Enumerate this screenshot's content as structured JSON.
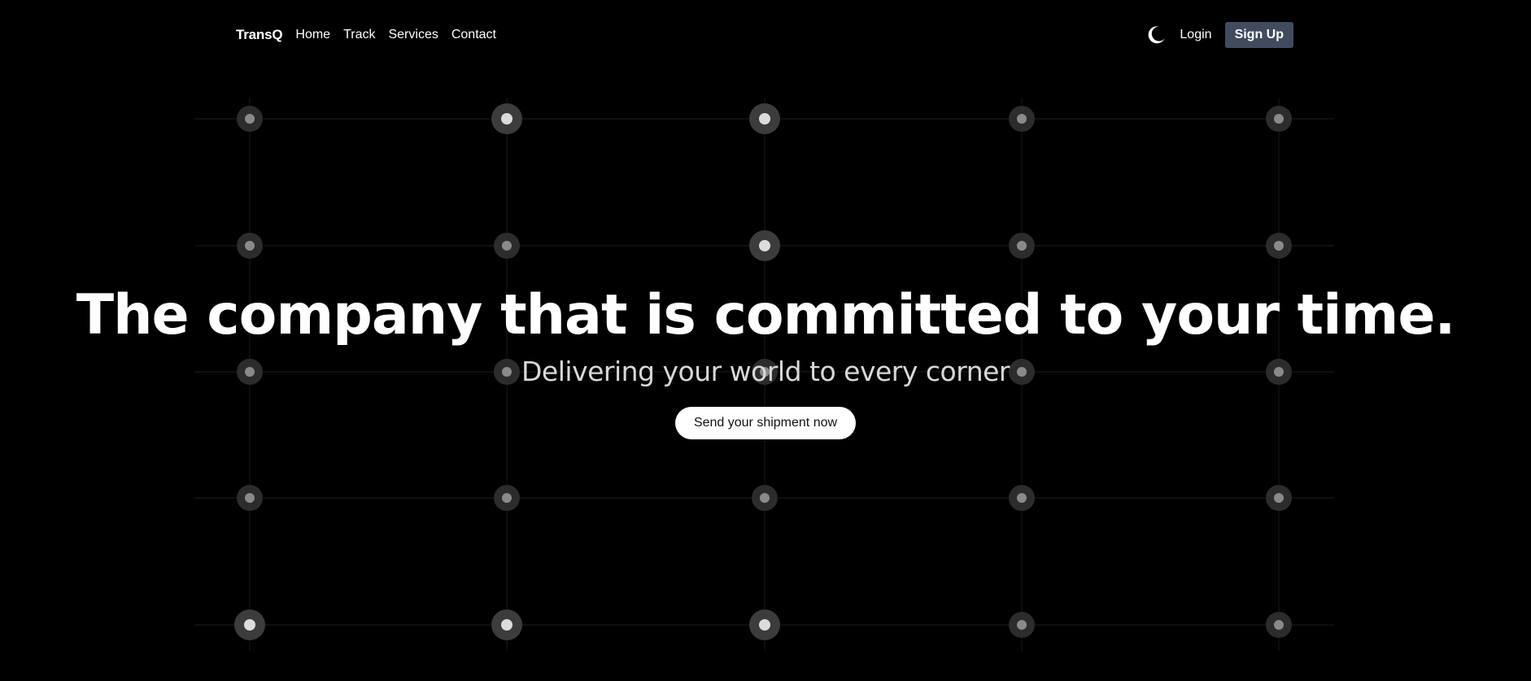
{
  "nav": {
    "brand": "TransQ",
    "links": [
      "Home",
      "Track",
      "Services",
      "Contact"
    ],
    "theme_icon": "moon-icon",
    "login": "Login",
    "signup": "Sign Up"
  },
  "hero": {
    "title": "The company that is committed to your time.",
    "subtitle": "Delivering your world to every corner",
    "cta": "Send your shipment now"
  },
  "colors": {
    "background": "#000000",
    "signup_bg": "#414b5e",
    "cta_bg": "#ffffff",
    "node_ring": "#3a3a3a",
    "node_core": "#c8c8c8"
  }
}
